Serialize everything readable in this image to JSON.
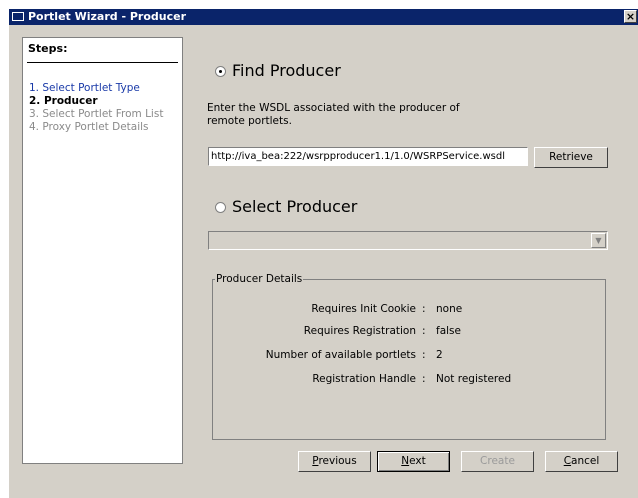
{
  "window": {
    "title": "Portlet Wizard - Producer",
    "close_glyph": "×"
  },
  "steps": {
    "heading": "Steps:",
    "items": [
      {
        "label": "1. Select Portlet Type",
        "state": "done"
      },
      {
        "label": "2. Producer",
        "state": "current"
      },
      {
        "label": "3. Select Portlet From List",
        "state": "pending"
      },
      {
        "label": "4. Proxy Portlet Details",
        "state": "pending"
      }
    ]
  },
  "find_producer": {
    "label": "Find Producer",
    "selected": true,
    "description": "Enter the WSDL associated with the producer of remote portlets.",
    "wsdl_value": "http://iva_bea:222/wsrpproducer1.1/1.0/WSRPService.wsdl",
    "retrieve_label": "Retrieve"
  },
  "select_producer": {
    "label": "Select Producer",
    "selected": false,
    "value": ""
  },
  "producer_details": {
    "legend": "Producer Details",
    "rows": [
      {
        "label": "Requires Init Cookie",
        "value": "none"
      },
      {
        "label": "Requires Registration",
        "value": "false"
      },
      {
        "label": "Number of available portlets",
        "value": "2"
      },
      {
        "label": "Registration Handle",
        "value": "Not registered"
      }
    ]
  },
  "buttons": {
    "previous": {
      "pre": "",
      "ul": "P",
      "post": "revious"
    },
    "next": {
      "pre": "",
      "ul": "N",
      "post": "ext"
    },
    "create": {
      "label": "Create",
      "enabled": false
    },
    "cancel": {
      "pre": "",
      "ul": "C",
      "post": "ancel"
    }
  },
  "icons": {
    "window": "window-icon",
    "close": "close-icon",
    "dropdown": "chevron-down-icon"
  }
}
